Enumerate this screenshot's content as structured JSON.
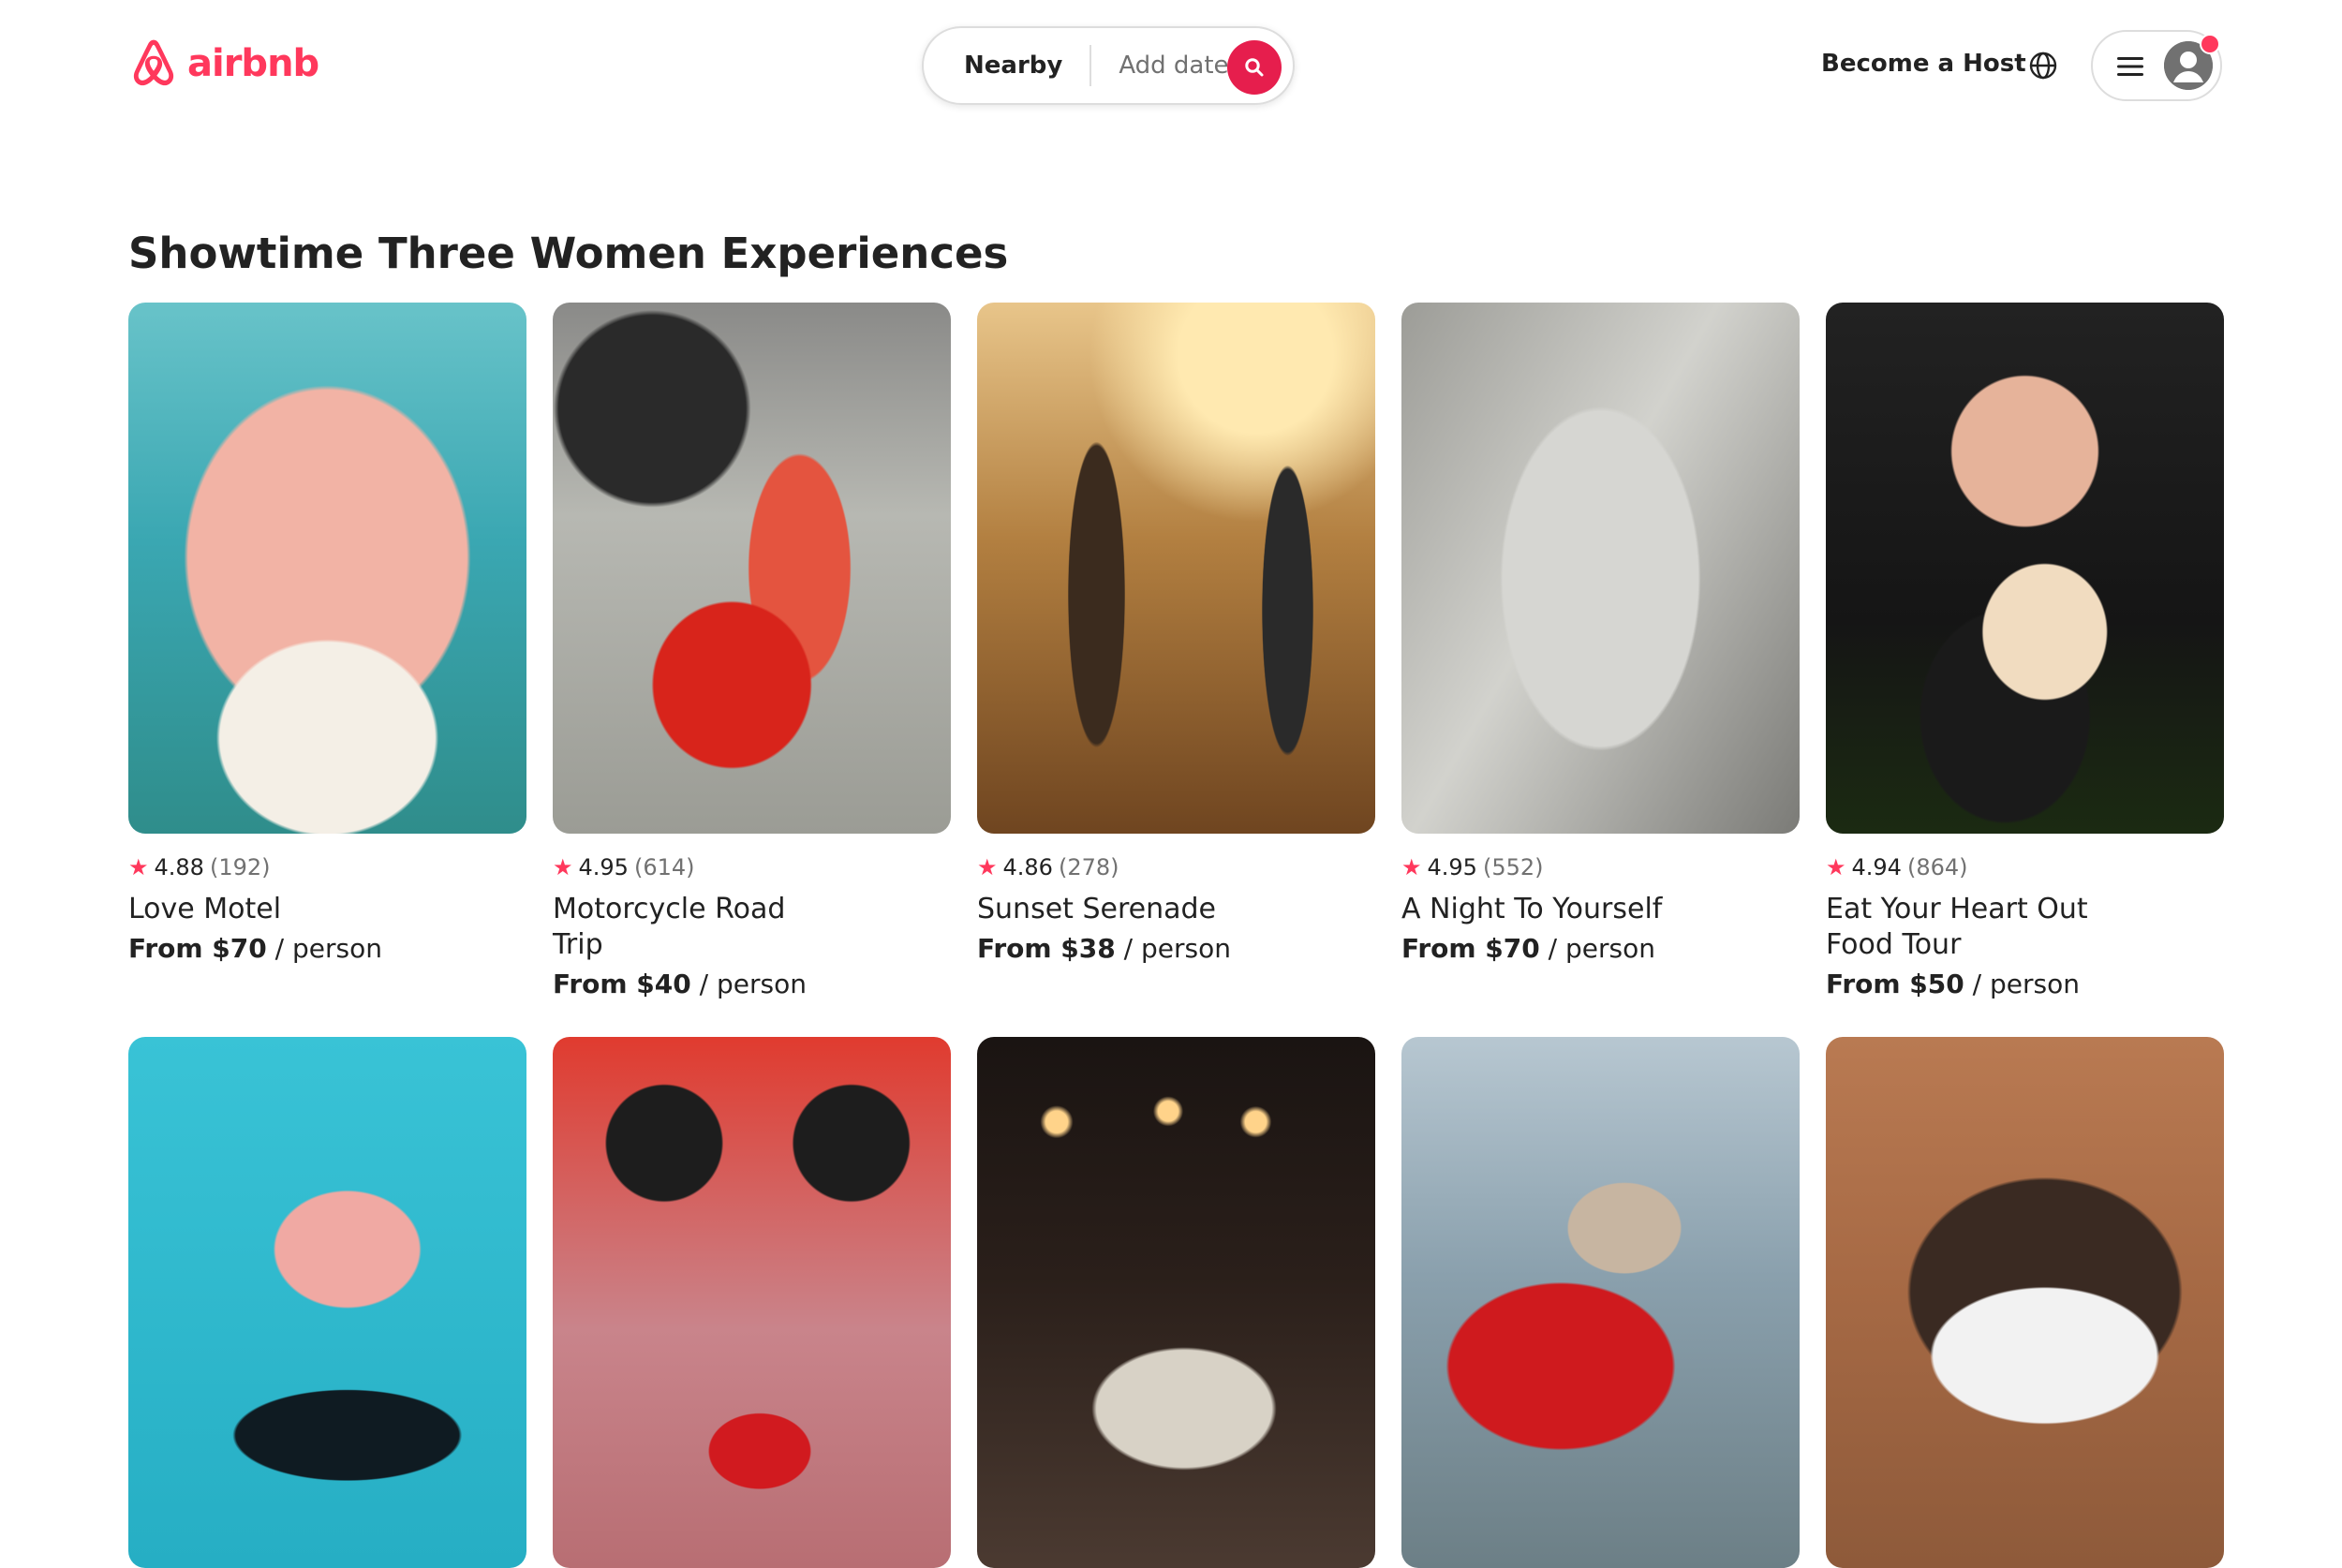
{
  "brand": {
    "name": "airbnb",
    "accent": "#FF385C",
    "search_button_color": "#E61E4D"
  },
  "header": {
    "search": {
      "location_label": "Nearby",
      "date_placeholder": "Add date"
    },
    "become_host_label": "Become a Host",
    "icons": {
      "search": "search-icon",
      "globe": "globe-icon",
      "menu": "menu-icon",
      "avatar": "avatar-icon"
    }
  },
  "section": {
    "title": "Showtime Three Women Experiences"
  },
  "experiences": [
    {
      "rating": "4.88",
      "reviews": "(192)",
      "title": "Love Motel",
      "price_prefix": "From $70",
      "price_suffix": "/ person"
    },
    {
      "rating": "4.95",
      "reviews": "(614)",
      "title": "Motorcycle Road Trip",
      "price_prefix": "From $40",
      "price_suffix": "/ person"
    },
    {
      "rating": "4.86",
      "reviews": "(278)",
      "title": "Sunset Serenade",
      "price_prefix": "From $38",
      "price_suffix": "/ person"
    },
    {
      "rating": "4.95",
      "reviews": "(552)",
      "title": "A Night To Yourself",
      "price_prefix": "From $70",
      "price_suffix": "/ person"
    },
    {
      "rating": "4.94",
      "reviews": "(864)",
      "title": "Eat Your Heart Out Food Tour",
      "price_prefix": "From $50",
      "price_suffix": "/ person"
    }
  ]
}
